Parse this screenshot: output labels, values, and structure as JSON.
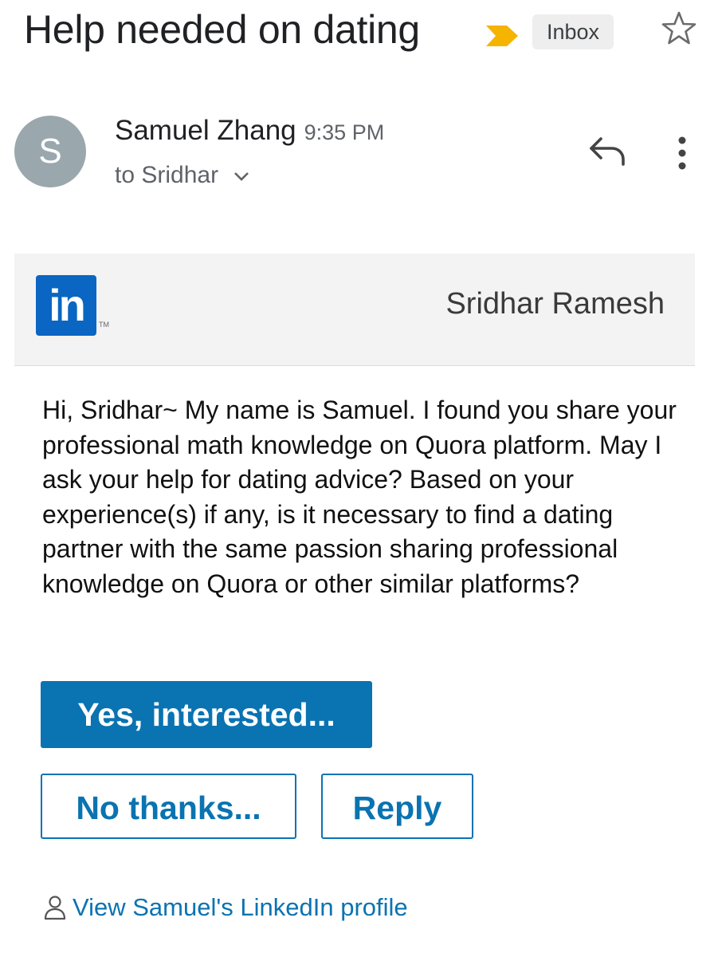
{
  "email": {
    "subject": "Help needed on dating",
    "label": "Inbox",
    "icons": {
      "importance": "importance-marker-icon",
      "star": "star-icon",
      "reply": "reply-icon",
      "more": "more-vert-icon",
      "chevron": "chevron-down-icon",
      "person": "person-icon"
    },
    "colors": {
      "importance": "#f4b400",
      "linkedin_blue": "#0a66c2",
      "button_blue": "#0a73b1"
    }
  },
  "sender": {
    "avatar_letter": "S",
    "name": "Samuel Zhang",
    "time": "9:35 PM",
    "recipient": "to Sridhar"
  },
  "message": {
    "logo_text": "in",
    "logo_tm": "TM",
    "recipient_name": "Sridhar Ramesh",
    "body": "Hi, Sridhar~ My name is Samuel. I found you share your professional math knowledge on Quora platform. May I ask your help for dating advice? Based on your experience(s) if any, is it necessary to find a dating partner with the same passion sharing professional knowledge on Quora or other similar platforms?",
    "buttons": {
      "yes": "Yes, interested...",
      "no": "No thanks...",
      "reply": "Reply"
    },
    "profile_link": "View Samuel's LinkedIn profile"
  }
}
